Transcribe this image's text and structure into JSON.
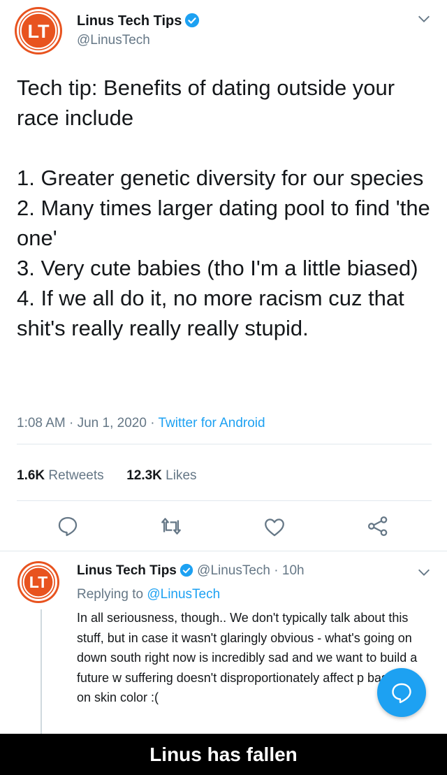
{
  "main_tweet": {
    "author_name": "Linus Tech Tips",
    "author_handle": "@LinusTech",
    "text": "Tech tip: Benefits of dating outside your race include\n\n1. Greater genetic diversity for our species\n2. Many times larger dating pool to find 'the one'\n3. Very cute babies (tho I'm a little biased)\n4. If we all do it, no more racism cuz that shit's really really really stupid.",
    "time": "1:08 AM",
    "date": "Jun 1, 2020",
    "source": "Twitter for Android",
    "retweets_count": "1.6K",
    "retweets_label": "Retweets",
    "likes_count": "12.3K",
    "likes_label": "Likes"
  },
  "reply": {
    "author_name": "Linus Tech Tips",
    "author_handle": "@LinusTech",
    "age": "10h",
    "replying_to_label": "Replying to",
    "replying_to_handle": "@LinusTech",
    "text": "In all seriousness, though.. We don't typically talk about this stuff, but in case it wasn't glaringly obvious - what's going on down south right now is incredibly sad and we want to build a future w suffering doesn't disproportionately affect p based on skin color :("
  },
  "caption": "Linus has fallen",
  "colors": {
    "accent": "#1da1f2",
    "brand": "#e8531f",
    "text": "#14171a",
    "secondary": "#657786"
  },
  "icons": [
    "verified-badge-icon",
    "chevron-down-icon",
    "reply-icon",
    "retweet-icon",
    "like-icon",
    "share-icon",
    "compose-reply-icon"
  ]
}
